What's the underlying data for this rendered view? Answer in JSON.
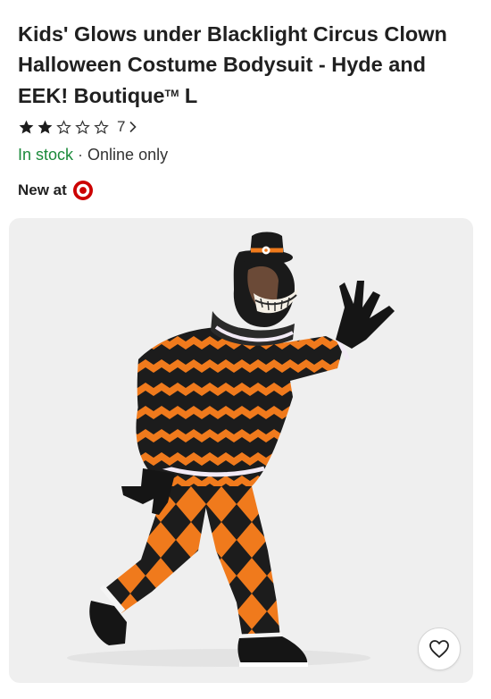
{
  "product": {
    "title": "Kids' Glows under Blacklight Circus Clown Halloween Costume Bodysuit - Hyde and EEK! Boutique",
    "trademark": "TM",
    "size": "L",
    "rating": {
      "stars": 2,
      "max_stars": 5,
      "review_count": "7"
    },
    "availability": {
      "in_stock": "In stock",
      "separator": "·",
      "channel": "Online only"
    },
    "new_at": "New at",
    "image_alt": "Child wearing orange and black harlequin clown costume with hood mask and mini top hat"
  },
  "colors": {
    "in_stock": "#1a8a3a",
    "brand_red": "#cc0000",
    "costume_orange": "#f07a1c",
    "costume_black": "#1c1c1c"
  },
  "icons": {
    "star_filled": "star-filled-icon",
    "star_empty": "star-outline-icon",
    "chevron": "chevron-right-icon",
    "brand": "bullseye-logo",
    "favorite": "heart-outline-icon"
  }
}
